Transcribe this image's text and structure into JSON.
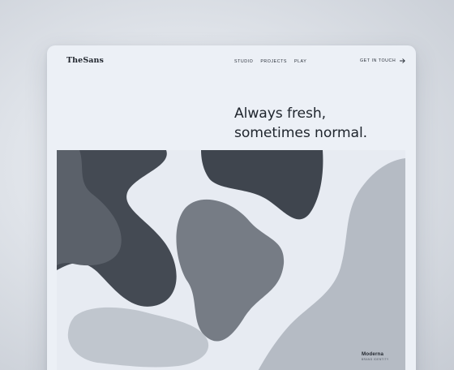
{
  "brand": {
    "name": "TheSans"
  },
  "nav": {
    "items": [
      {
        "label": "STUDIO"
      },
      {
        "label": "PROJECTS"
      },
      {
        "label": "PLAY"
      }
    ],
    "cta": {
      "label": "GET IN TOUCH",
      "icon": "arrow-right-icon"
    }
  },
  "hero": {
    "line1": "Always fresh,",
    "line2": "sometimes normal."
  },
  "project": {
    "title": "Moderna",
    "subtitle": "BRAND IDENTITY"
  },
  "colors": {
    "page_bg": "#ecf0f6",
    "text": "#20262e",
    "blob_dark": "#3d434c",
    "blob_mid": "#6e747d",
    "blob_light": "#b6bcc5"
  }
}
